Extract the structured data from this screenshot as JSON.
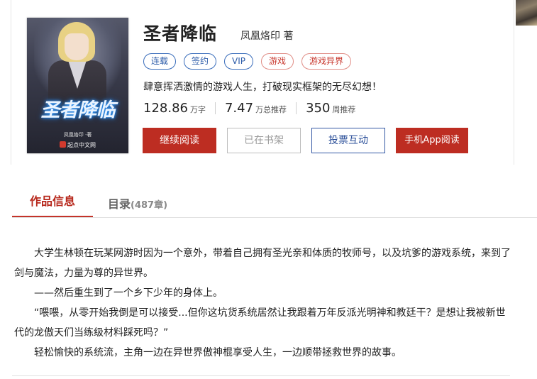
{
  "book": {
    "title": "圣者降临",
    "author": "凤凰烙印 著",
    "cover": {
      "title": "圣者降临",
      "author": "凤凰烙印 ·著",
      "publisher": "起点中文网"
    },
    "tags": [
      {
        "label": "连载",
        "color": "blue"
      },
      {
        "label": "签约",
        "color": "blue"
      },
      {
        "label": "VIP",
        "color": "blue"
      },
      {
        "label": "游戏",
        "color": "red"
      },
      {
        "label": "游戏异界",
        "color": "red"
      }
    ],
    "intro": "肆意挥洒激情的游戏人生，打破现实框架的无尽幻想！",
    "stats": [
      {
        "value": "128.86",
        "unit": "万字"
      },
      {
        "value": "7.47",
        "unit": "万总推荐"
      },
      {
        "value": "350",
        "unit": "周推荐"
      }
    ]
  },
  "buttons": {
    "read": "继续阅读",
    "shelf": "已在书架",
    "vote": "投票互动",
    "app": "手机App阅读"
  },
  "tabs": {
    "info": "作品信息",
    "toc": "目录",
    "toc_count": "(487章)"
  },
  "description": [
    "大学生林顿在玩某网游时因为一个意外，带着自己拥有圣光亲和体质的牧师号，以及坑爹的游戏系统，来到了剑与魔法，力量为尊的异世界。",
    "——然后重生到了一个乡下少年的身体上。",
    "“喂喂，从零开始我倒是可以接受...但你这坑货系统居然让我跟着万年反派光明神和教廷干？是想让我被新世代的龙傲天们当练级材料踩死吗？”",
    "轻松愉快的系统流，主角一边在异世界傲神棍享受人生，一边顺带拯救世界的故事。"
  ],
  "colors": {
    "accent_red": "#bd2d22",
    "accent_blue": "#3458a4"
  }
}
